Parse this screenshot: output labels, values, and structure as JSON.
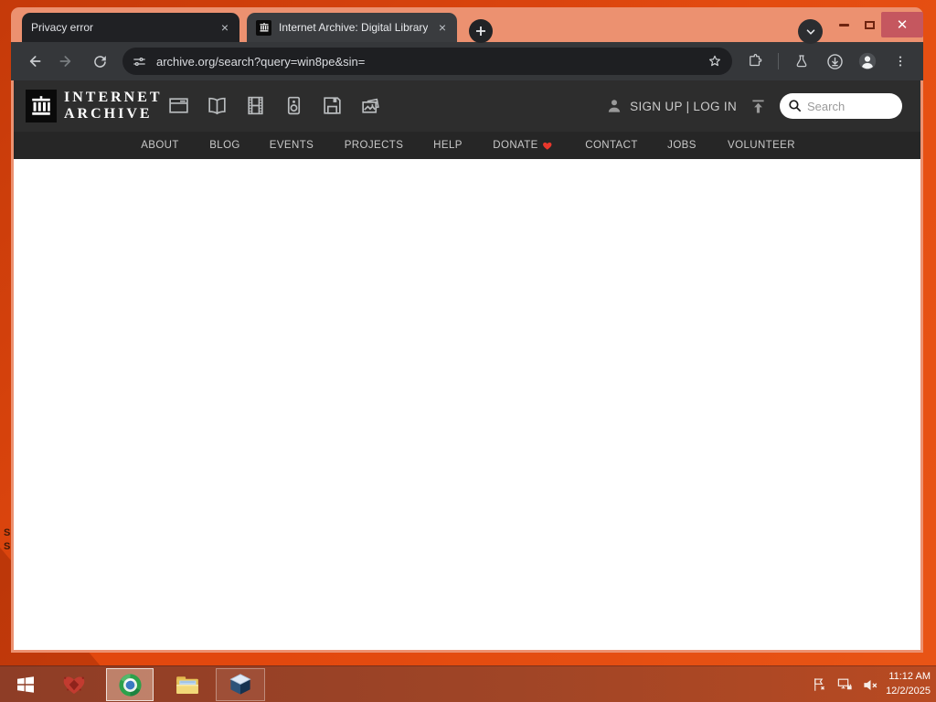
{
  "browser": {
    "tabs": [
      {
        "title": "Privacy error"
      },
      {
        "title": "Internet Archive: Digital Library"
      }
    ],
    "new_tab_button": "+",
    "url": "archive.org/search?query=win8pe&sin=",
    "toolbar_icons": [
      "back-arrow",
      "forward-arrow",
      "reload",
      "site-info",
      "bookmark-star",
      "extensions-puzzle",
      "labs-flask",
      "downloads",
      "profile-avatar",
      "menu-dots"
    ]
  },
  "ia": {
    "brand_line1": "INTERNET",
    "brand_line2": "ARCHIVE",
    "media_icons": [
      "web",
      "texts",
      "video",
      "audio",
      "software",
      "images"
    ],
    "auth_text": "SIGN UP | LOG IN",
    "upload_icon": "upload",
    "search_placeholder": "Search",
    "nav": [
      "ABOUT",
      "BLOG",
      "EVENTS",
      "PROJECTS",
      "HELP",
      "DONATE",
      "CONTACT",
      "JOBS",
      "VOLUNTEER"
    ]
  },
  "desktop": {
    "fragments": [
      "S",
      "S"
    ]
  },
  "taskbar": {
    "apps": [
      "start",
      "red-heart-app",
      "chrome",
      "file-explorer",
      "virtualbox"
    ],
    "tray_icons": [
      "action-center-flag",
      "network",
      "volume-muted"
    ],
    "clock_time": "11:12 AM",
    "clock_date": "12/2/2025"
  },
  "colors": {
    "desktop": "#E2480E",
    "frame": "#EC9170",
    "tab_inactive": "#202124",
    "tab_active": "#3A3C3F",
    "toolbar": "#35373A",
    "omnibox": "#1E1F22",
    "icon": "#C8CBCE",
    "icon_dim": "#797D80",
    "ia_header": "#2D2D2D",
    "ia_navbar": "#262626",
    "ia_icon": "#B9BCBE",
    "close_btn": "#C5575F",
    "taskbar_a": "#8E3D26",
    "taskbar_b": "#B84A22",
    "heart": "#E8372C"
  }
}
